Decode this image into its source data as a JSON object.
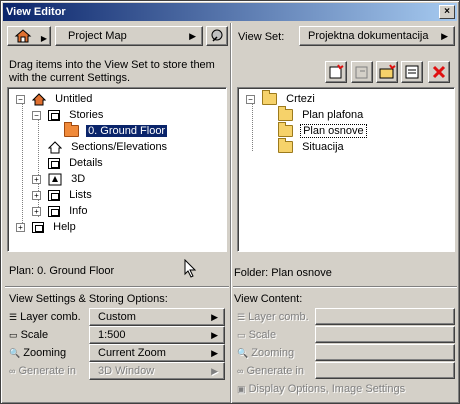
{
  "window": {
    "title": "View Editor",
    "close": "×"
  },
  "left": {
    "map_button": "Project Map",
    "hint": "Drag items into the View Set to store them with the current Settings.",
    "tree": [
      {
        "label": "Untitled"
      },
      {
        "label": "Stories"
      },
      {
        "label": "0. Ground Floor"
      },
      {
        "label": "Sections/Elevations"
      },
      {
        "label": "Details"
      },
      {
        "label": "3D"
      },
      {
        "label": "Lists"
      },
      {
        "label": "Info"
      },
      {
        "label": "Help"
      }
    ],
    "status": "Plan: 0. Ground Floor",
    "settings_title": "View Settings & Storing Options:",
    "settings": [
      {
        "label": "Layer comb.",
        "value": "Custom",
        "icon": "layers-icon"
      },
      {
        "label": "Scale",
        "value": "1:500",
        "icon": "scale-icon"
      },
      {
        "label": "Zooming",
        "value": "Current Zoom",
        "icon": "zoom-icon"
      },
      {
        "label": "Generate in",
        "value": "3D Window",
        "icon": "generate-icon"
      }
    ]
  },
  "right": {
    "viewset_label": "View Set:",
    "viewset_value": "Projektna dokumentacija",
    "tree": [
      {
        "label": "Crtezi"
      },
      {
        "label": "Plan plafona"
      },
      {
        "label": "Plan osnove"
      },
      {
        "label": "Situacija"
      }
    ],
    "status": "Folder: Plan osnove",
    "content_title": "View Content:",
    "content": [
      {
        "label": "Layer comb."
      },
      {
        "label": "Scale"
      },
      {
        "label": "Zooming"
      },
      {
        "label": "Generate in"
      }
    ],
    "display_options": "Display Options, Image Settings"
  },
  "colors": {
    "title_start": "#0a246a",
    "title_end": "#a6caf0",
    "selection": "#0a246a",
    "delete_red": "#e01010"
  }
}
